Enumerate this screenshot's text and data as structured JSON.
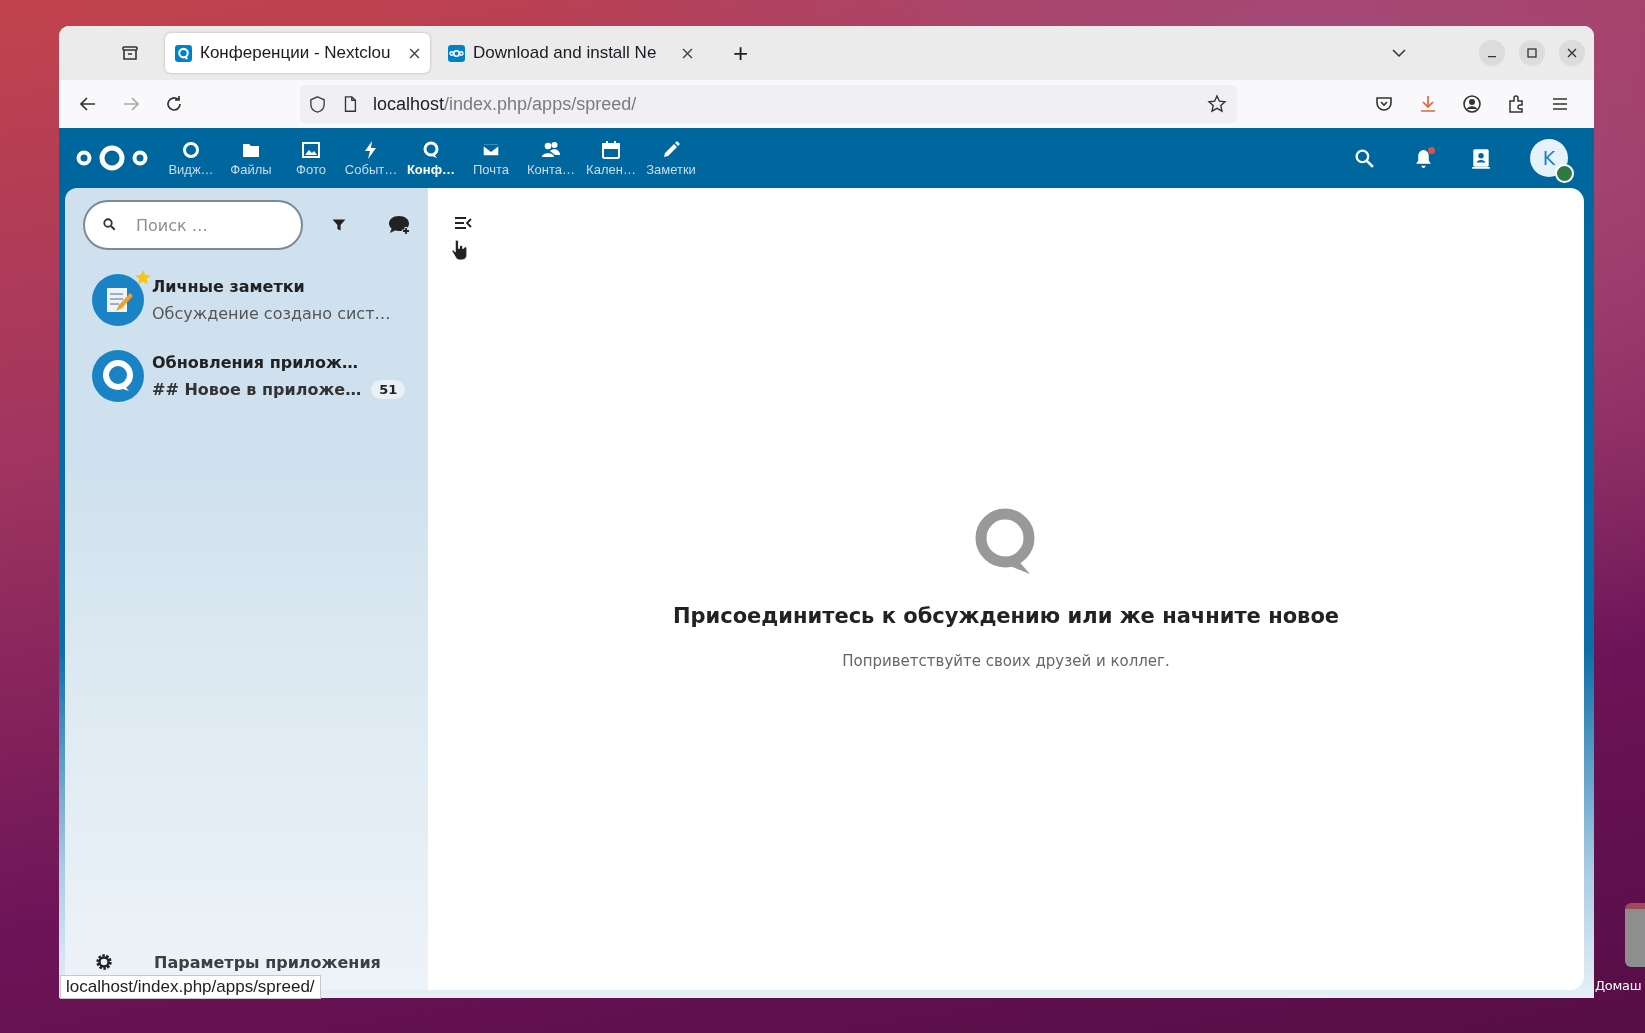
{
  "desktop": {
    "icon_label": "Домаш"
  },
  "browser": {
    "tabs": [
      {
        "title": "Конференции - Nextclou",
        "selected": true,
        "kind": "talk"
      },
      {
        "title": "Download and install Ne",
        "selected": false,
        "kind": "nextcloud"
      }
    ],
    "new_tab": "+",
    "address": {
      "host": "localhost",
      "path": "/index.php/apps/spreed/"
    },
    "status_url": "localhost/index.php/apps/spreed/"
  },
  "header": {
    "apps": [
      {
        "label": "Видж…",
        "kind": "widgets",
        "selected": false
      },
      {
        "label": "Файлы",
        "kind": "files",
        "selected": false
      },
      {
        "label": "Фото",
        "kind": "photos",
        "selected": false
      },
      {
        "label": "Событ…",
        "kind": "activity",
        "selected": false
      },
      {
        "label": "Конф…",
        "kind": "talk",
        "selected": true
      },
      {
        "label": "Почта",
        "kind": "mail",
        "selected": false
      },
      {
        "label": "Конта…",
        "kind": "contacts",
        "selected": false
      },
      {
        "label": "Кален…",
        "kind": "calendar",
        "selected": false
      },
      {
        "label": "Заметки",
        "kind": "notes",
        "selected": false
      }
    ],
    "notifications_unread": true,
    "user": {
      "initial": "K",
      "online": true
    }
  },
  "sidebar": {
    "search": {
      "placeholder": "Поиск …"
    },
    "conversations": [
      {
        "title": "Личные заметки",
        "subtitle": "Обсуждение создано сист…",
        "kind": "notes",
        "favorite": true
      },
      {
        "title": "Обновления прилож…",
        "subtitle": "## Новое в приложе…",
        "kind": "talk",
        "favorite": false,
        "unread": "51"
      }
    ],
    "settings_label": "Параметры приложения"
  },
  "empty_state": {
    "title": "Присоединитесь к обсуждению или же начните новое",
    "text": "Поприветствуйте своих друзей и коллег."
  }
}
